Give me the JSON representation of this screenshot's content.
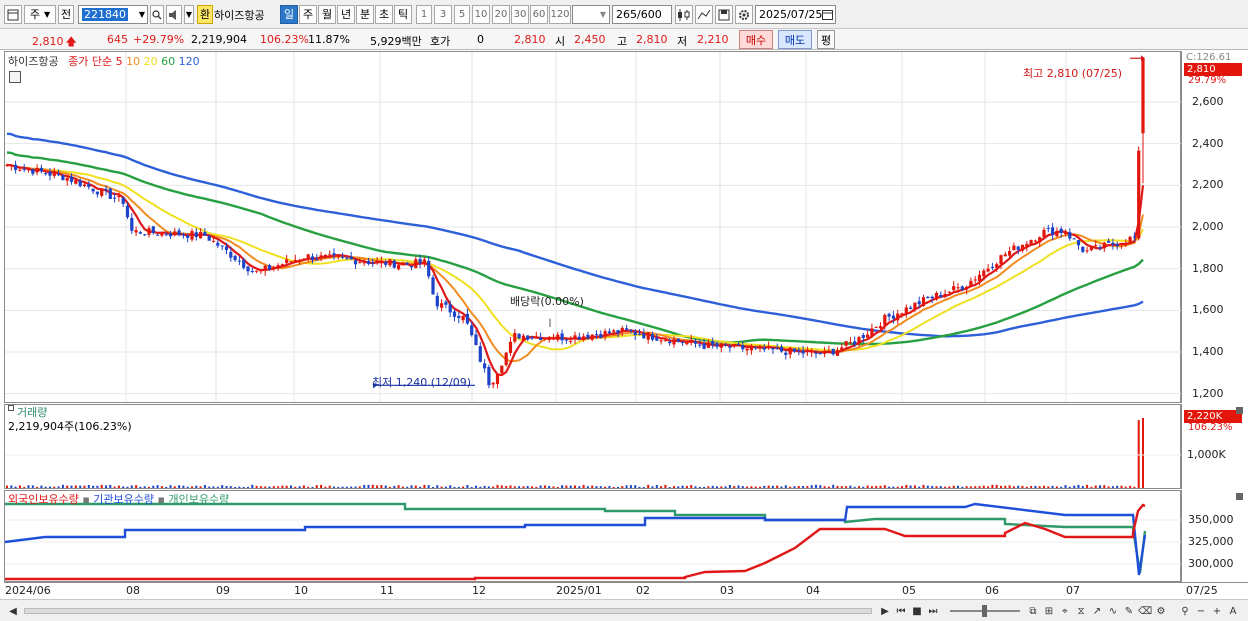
{
  "toolbar": {
    "period_main": "주",
    "prev_label": "전",
    "code": "221840",
    "fx_label": "환",
    "stock_name": "하이즈항공",
    "periods": [
      "일",
      "주",
      "월",
      "년",
      "분",
      "초",
      "틱"
    ],
    "active_period": "일",
    "minute_options": [
      "1",
      "3",
      "5",
      "10",
      "20",
      "30",
      "60",
      "120"
    ],
    "count": "265",
    "count_total": "/600",
    "date": "2025/07/25"
  },
  "quote": {
    "price": "2,810",
    "change": "645",
    "change_pct": "+29.79%",
    "volume": "2,219,904",
    "volume_ratio": "106.23%",
    "turnover": "11.87%",
    "amount": "5,929백만",
    "hoga_label": "호가",
    "hoga_value": "0",
    "hoga_price": "2,810",
    "open_label": "시",
    "open": "2,450",
    "high_label": "고",
    "high": "2,810",
    "low_label": "저",
    "low": "2,210",
    "buy_label": "매수",
    "sell_label": "매도",
    "avg_label": "평"
  },
  "price_panel": {
    "legend_name": "하이즈항공",
    "legend_ma": "종가 단순",
    "ma_periods": [
      "5",
      "10",
      "20",
      "60",
      "120"
    ],
    "ma_colors": [
      "#e01818",
      "#f08c20",
      "#f0e020",
      "#27a042",
      "#2d5fd8"
    ],
    "y_axis_ticks": [
      "2,600",
      "2,400",
      "2,200",
      "2,000",
      "1,800",
      "1,600",
      "1,400",
      "1,200"
    ],
    "top_label": "C:126.61",
    "last_price_tag": "2,810",
    "last_change_tag": "29.79%",
    "high_annotation": "최고 2,810 (07/25)",
    "low_annotation": "최저 1,240 (12/09)",
    "dividend_annotation": "배당락(0.00%)"
  },
  "volume_panel": {
    "title": "거래량",
    "value": "2,219,904주(106.23%)",
    "tag": "2,220K",
    "tag_pct": "106.23%",
    "tick": "1,000K"
  },
  "holdings_panel": {
    "legend": [
      "외국인보유수량",
      "기관보유수량",
      "개인보유수량"
    ],
    "colors": [
      "#e01818",
      "#1f4fd8",
      "#2e9a6a"
    ],
    "ticks": [
      "350,000",
      "325,000",
      "300,000"
    ]
  },
  "x_axis": [
    "2024/06",
    "08",
    "09",
    "10",
    "11",
    "12",
    "2025/01",
    "02",
    "03",
    "04",
    "05",
    "06",
    "07",
    "07/25"
  ],
  "chart_data": {
    "type": "candlestick",
    "ylim": [
      1160,
      2840
    ],
    "ma_end_values": {
      "5": 2160,
      "10": 1960,
      "20": 1940,
      "60": 1830,
      "120": 1630
    },
    "close_path": [
      [
        "2024/06",
        2300
      ],
      [
        "07",
        2240
      ],
      [
        "08",
        2120
      ],
      [
        "08",
        1980
      ],
      [
        "09",
        1960
      ],
      [
        "09",
        1780
      ],
      [
        "10",
        1860
      ],
      [
        "10",
        1840
      ],
      [
        "11",
        1820
      ],
      [
        "11",
        1830
      ],
      [
        "11",
        1640
      ],
      [
        "12",
        1560
      ],
      [
        "12/09",
        1240
      ],
      [
        "12",
        1480
      ],
      [
        "2025/01",
        1470
      ],
      [
        "02",
        1500
      ],
      [
        "03",
        1430
      ],
      [
        "03",
        1410
      ],
      [
        "04",
        1390
      ],
      [
        "04",
        1450
      ],
      [
        "05",
        1560
      ],
      [
        "05",
        1650
      ],
      [
        "06",
        1720
      ],
      [
        "06",
        1870
      ],
      [
        "06",
        1980
      ],
      [
        "07",
        1980
      ],
      [
        "07",
        1880
      ],
      [
        "07",
        1950
      ],
      [
        "07/25",
        2810
      ]
    ]
  }
}
